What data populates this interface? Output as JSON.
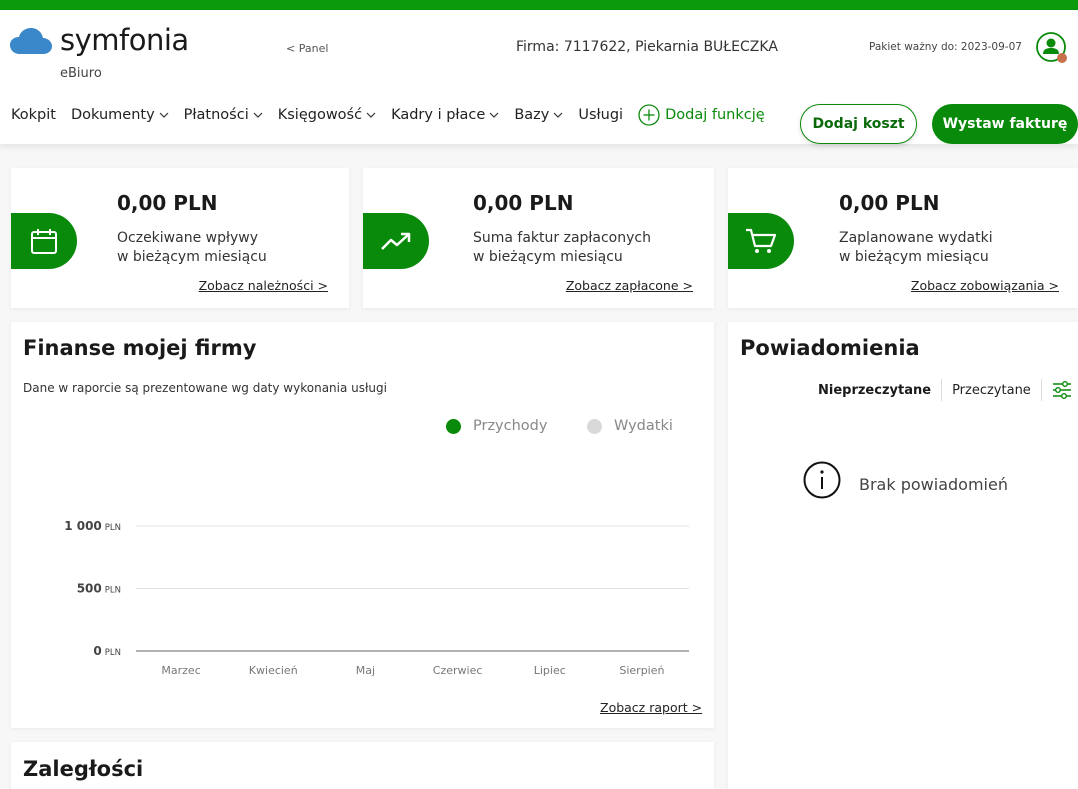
{
  "header": {
    "logo_text": "symfonia",
    "logo_sub": "eBiuro",
    "panel_link": "< Panel",
    "company": "Firma:  7117622, Piekarnia BUŁECZKA",
    "package": "Pakiet ważny do: 2023-09-07"
  },
  "nav": {
    "items": [
      {
        "label": "Kokpit",
        "dropdown": false
      },
      {
        "label": "Dokumenty",
        "dropdown": true
      },
      {
        "label": "Płatności",
        "dropdown": true
      },
      {
        "label": "Księgowość",
        "dropdown": true
      },
      {
        "label": "Kadry i płace",
        "dropdown": true
      },
      {
        "label": "Bazy",
        "dropdown": true
      },
      {
        "label": "Usługi",
        "dropdown": false
      }
    ],
    "add_function": "Dodaj funkcję",
    "add_cost": "Dodaj koszt",
    "issue_invoice": "Wystaw fakturę"
  },
  "stats": [
    {
      "amount": "0,00 PLN",
      "line1": "Oczekiwane wpływy",
      "line2": "w bieżącym miesiącu",
      "link": "Zobacz należności >",
      "icon": "calendar-icon"
    },
    {
      "amount": "0,00 PLN",
      "line1": "Suma faktur zapłaconych",
      "line2": "w bieżącym miesiącu",
      "link": "Zobacz zapłacone >",
      "icon": "trend-up-icon"
    },
    {
      "amount": "0,00 PLN",
      "line1": "Zaplanowane wydatki",
      "line2": "w bieżącym miesiącu",
      "link": "Zobacz zobowiązania >",
      "icon": "cart-icon"
    }
  ],
  "finance": {
    "title": "Finanse mojej firmy",
    "subtitle": "Dane w raporcie są prezentowane wg daty wykonania usługi",
    "report_link": "Zobacz raport >"
  },
  "chart_data": {
    "type": "bar",
    "categories": [
      "Marzec",
      "Kwiecień",
      "Maj",
      "Czerwiec",
      "Lipiec",
      "Sierpień"
    ],
    "series": [
      {
        "name": "Przychody",
        "values": [
          0,
          0,
          0,
          0,
          0,
          0
        ],
        "color": "#0a8a0a"
      },
      {
        "name": "Wydatki",
        "values": [
          0,
          0,
          0,
          0,
          0,
          0
        ],
        "color": "#d9d9d9"
      }
    ],
    "ylim": [
      0,
      1000
    ],
    "ticks": [
      {
        "value": 0,
        "num": "0",
        "unit": "PLN"
      },
      {
        "value": 500,
        "num": "500",
        "unit": "PLN"
      },
      {
        "value": 1000,
        "num": "1 000",
        "unit": "PLN"
      }
    ],
    "grid": true,
    "legend_position": "top-right"
  },
  "notifications": {
    "title": "Powiadomienia",
    "tab_unread": "Nieprzeczytane",
    "tab_read": "Przeczytane",
    "empty": "Brak powiadomień"
  },
  "overdue": {
    "title": "Zaległości"
  },
  "colors": {
    "brand_green": "#0a8a0a",
    "top_bar": "#0a9a0a",
    "logo_blue": "#3a87c9"
  }
}
